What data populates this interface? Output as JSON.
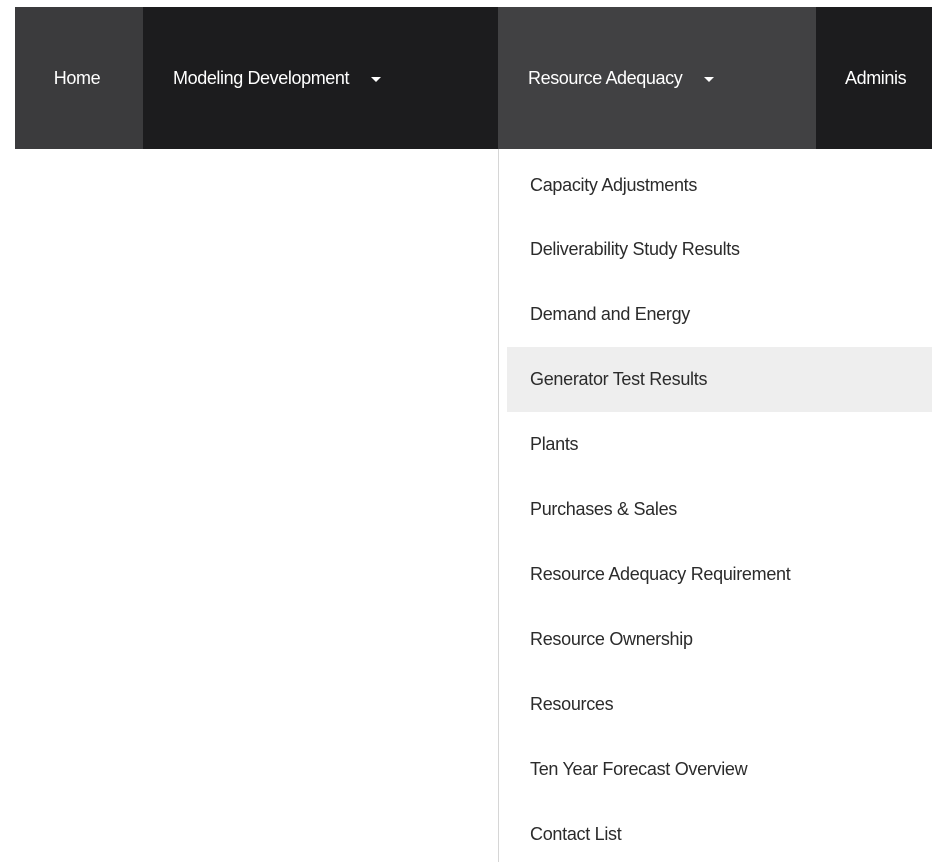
{
  "nav": {
    "home": "Home",
    "modeling": "Modeling Development",
    "resource": "Resource Adequacy",
    "admin": "Adminis"
  },
  "dropdown": {
    "items": [
      "Capacity Adjustments",
      "Deliverability Study Results",
      "Demand and Energy",
      "Generator Test Results",
      "Plants",
      "Purchases & Sales",
      "Resource Adequacy Requirement",
      "Resource Ownership",
      "Resources",
      "Ten Year Forecast Overview",
      "Contact List"
    ],
    "highlighted": "Generator Test Results"
  },
  "colors": {
    "navbar_bg": "#1c1c1e",
    "home_bg": "#3b3b3d",
    "resource_active_bg": "#414143",
    "hover_bg": "#eeeeee",
    "menu_text": "#2b2b2b"
  }
}
